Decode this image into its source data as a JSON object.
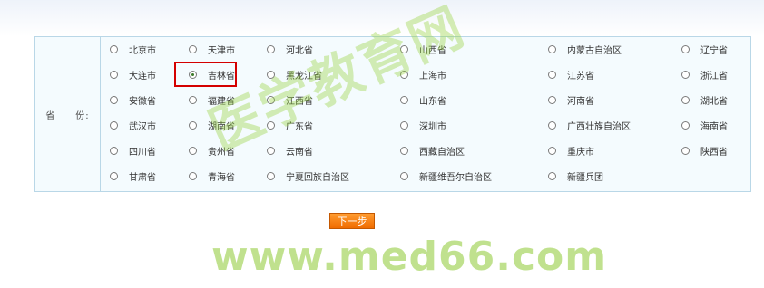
{
  "form": {
    "province_label": "省　　份:",
    "selected": "吉林省",
    "next_button": "下一步",
    "provinces": [
      [
        "北京市",
        "天津市",
        "河北省",
        "山西省",
        "内蒙古自治区",
        "辽宁省"
      ],
      [
        "大连市",
        "吉林省",
        "黑龙江省",
        "上海市",
        "江苏省",
        "浙江省"
      ],
      [
        "安徽省",
        "福建省",
        "江西省",
        "山东省",
        "河南省",
        "湖北省"
      ],
      [
        "武汉市",
        "湖南省",
        "广东省",
        "深圳市",
        "广西壮族自治区",
        "海南省"
      ],
      [
        "四川省",
        "贵州省",
        "云南省",
        "西藏自治区",
        "重庆市",
        "陕西省"
      ],
      [
        "甘肃省",
        "青海省",
        "宁夏回族自治区",
        "新疆维吾尔自治区",
        "新疆兵团"
      ]
    ]
  },
  "watermark": {
    "chinese": "医学教育网",
    "url": "www.med66.com"
  }
}
